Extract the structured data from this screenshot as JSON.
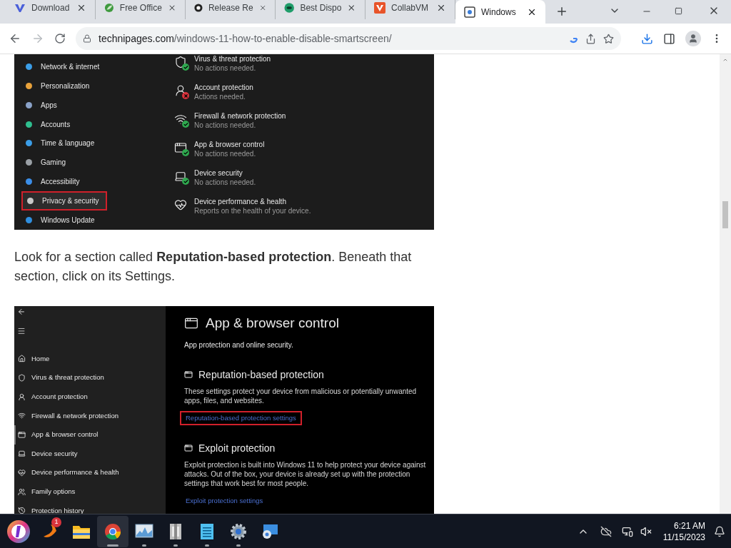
{
  "browser": {
    "tabs": [
      {
        "title": "Download",
        "kind": "v",
        "selected": false
      },
      {
        "title": "Free Office",
        "kind": "leaf",
        "selected": false
      },
      {
        "title": "Release Re",
        "kind": "github",
        "selected": false
      },
      {
        "title": "Best Dispo",
        "kind": "green",
        "selected": false
      },
      {
        "title": "CollabVM",
        "kind": "vm",
        "selected": false
      },
      {
        "title": "Windows",
        "kind": "page",
        "selected": true
      }
    ],
    "url": {
      "domain": "technipages.com",
      "path": "/windows-11-how-to-enable-disable-smartscreen/"
    }
  },
  "article": {
    "figure_1": {
      "nav_items": [
        {
          "label": "Network & internet",
          "color": "#3b9ee8",
          "selected": false
        },
        {
          "label": "Personalization",
          "color": "#e8a23b",
          "selected": false
        },
        {
          "label": "Apps",
          "color": "#8aa2c8",
          "selected": false
        },
        {
          "label": "Accounts",
          "color": "#2fbf8f",
          "selected": false
        },
        {
          "label": "Time & language",
          "color": "#3b9ee8",
          "selected": false
        },
        {
          "label": "Gaming",
          "color": "#9aa0a6",
          "selected": false
        },
        {
          "label": "Accessibility",
          "color": "#3b8ee8",
          "selected": false
        },
        {
          "label": "Privacy & security",
          "color": "#c8c8c8",
          "selected": true
        },
        {
          "label": "Windows Update",
          "color": "#2f8fe0",
          "selected": false
        }
      ],
      "items": [
        {
          "title": "Virus & threat protection",
          "status": "No actions needed.",
          "ok": true
        },
        {
          "title": "Account protection",
          "status": "Actions needed.",
          "ok": false
        },
        {
          "title": "Firewall & network protection",
          "status": "No actions needed.",
          "ok": true
        },
        {
          "title": "App & browser control",
          "status": "No actions needed.",
          "ok": true
        },
        {
          "title": "Device security",
          "status": "No actions needed.",
          "ok": true
        },
        {
          "title": "Device performance & health",
          "status": "Reports on the health of your device."
        }
      ]
    },
    "paragraph": "Look for a section called **Reputation-based protection**. Beneath that section, click on its Settings.",
    "figure_2": {
      "nav_items": [
        {
          "label": "Home",
          "selected": false
        },
        {
          "label": "Virus & threat protection",
          "selected": false
        },
        {
          "label": "Account protection",
          "selected": false
        },
        {
          "label": "Firewall & network protection",
          "selected": false
        },
        {
          "label": "App & browser control",
          "selected": true
        },
        {
          "label": "Device security",
          "selected": false
        },
        {
          "label": "Device performance & health",
          "selected": false
        },
        {
          "label": "Family options",
          "selected": false
        },
        {
          "label": "Protection history",
          "selected": false
        }
      ],
      "title": "App & browser control",
      "subtitle": "App protection and online security.",
      "sections": [
        {
          "heading": "Reputation-based protection",
          "body": "These settings protect your device from malicious or potentially unwanted apps, files, and websites.",
          "link": "Reputation-based protection settings",
          "highlighted": true
        },
        {
          "heading": "Exploit protection",
          "body": "Exploit protection is built into Windows 11 to help protect your device against attacks.  Out of the box, your device is already set up with the protection settings that work best for most people.",
          "link": "Exploit protection settings",
          "highlighted": false
        }
      ]
    }
  },
  "taskbar": {
    "apps": [
      {
        "kind": "start",
        "running": false,
        "active": false
      },
      {
        "kind": "firefox",
        "badge": "1",
        "running": false,
        "active": false
      },
      {
        "kind": "folder",
        "running": false,
        "active": false
      },
      {
        "kind": "chrome",
        "running": true,
        "active": true
      },
      {
        "kind": "monitor",
        "running": true,
        "active": false
      },
      {
        "kind": "archive",
        "running": true,
        "active": false
      },
      {
        "kind": "notepad",
        "running": true,
        "active": false
      },
      {
        "kind": "settings",
        "running": true,
        "active": false
      },
      {
        "kind": "remote",
        "running": false,
        "active": false
      }
    ],
    "time": "6:21 AM",
    "date": "11/15/2023"
  }
}
